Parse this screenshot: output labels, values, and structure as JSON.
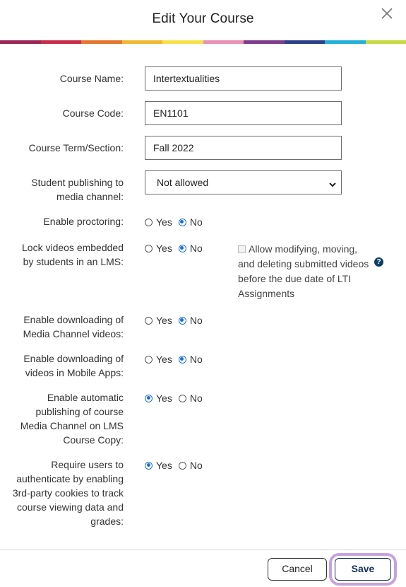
{
  "dialog": {
    "title": "Edit Your Course"
  },
  "colors": {
    "accent": "#1a6ed8",
    "primary_button": "#13315c",
    "focus_ring": "#c7a3de",
    "rainbow": [
      "#9a2756",
      "#c72c48",
      "#e5762d",
      "#f2b833",
      "#f6e14c",
      "#ec8fb7",
      "#7d3c8c",
      "#2b3f8c",
      "#23b0d9",
      "#c7d840"
    ]
  },
  "form": {
    "course_name": {
      "label": "Course Name:",
      "value": "Intertextualities"
    },
    "course_code": {
      "label": "Course Code:",
      "value": "EN1101"
    },
    "course_term": {
      "label": "Course Term/Section:",
      "value": "Fall 2022"
    },
    "student_publishing": {
      "label": "Student publishing to media channel:",
      "selected": "Not allowed"
    },
    "enable_proctoring": {
      "label": "Enable proctoring:",
      "yes": "Yes",
      "no": "No",
      "selected": "No"
    },
    "lock_videos": {
      "label": "Lock videos embedded by students in an LMS:",
      "yes": "Yes",
      "no": "No",
      "selected": "No",
      "extra_checkbox_label": "Allow modifying, moving, and deleting submitted videos before the due date of LTI Assignments",
      "extra_checked": false,
      "help_icon": "question-circle-icon"
    },
    "download_media_channel": {
      "label": "Enable downloading of Media Channel videos:",
      "yes": "Yes",
      "no": "No",
      "selected": "No"
    },
    "download_mobile": {
      "label": "Enable downloading of videos in Mobile Apps:",
      "yes": "Yes",
      "no": "No",
      "selected": "No"
    },
    "auto_publish": {
      "label": "Enable automatic publishing of course Media Channel on LMS Course Copy:",
      "yes": "Yes",
      "no": "No",
      "selected": "Yes"
    },
    "require_cookies": {
      "label": "Require users to authenticate by enabling 3rd-party cookies to track course viewing data and grades:",
      "yes": "Yes",
      "no": "No",
      "selected": "Yes"
    }
  },
  "footer": {
    "cancel_label": "Cancel",
    "save_label": "Save"
  },
  "icons": {
    "close": "close-icon",
    "dropdown": "chevron-down-icon",
    "help": "question-circle-icon"
  }
}
